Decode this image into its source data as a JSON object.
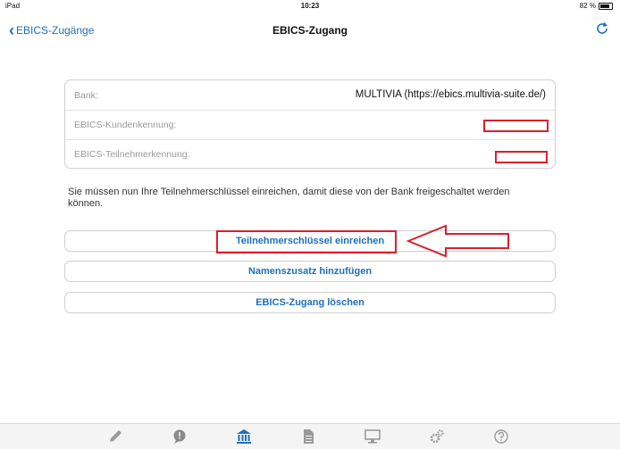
{
  "status": {
    "device": "iPad",
    "time": "10:23",
    "battery": "82 %"
  },
  "nav": {
    "back_label": "EBICS-Zugänge",
    "title": "EBICS-Zugang"
  },
  "info": {
    "bank_label": "Bank:",
    "bank_value": "MULTIVIA (https://ebics.multivia-suite.de/)",
    "customer_id_label": "EBICS-Kundenkennung:",
    "user_id_label": "EBICS-Teilnehmerkennung:"
  },
  "notice": "Sie müssen nun Ihre Teilnehmerschlüssel einreichen, damit diese von der Bank freigeschaltet werden können.",
  "buttons": {
    "submit_keys": "Teilnehmerschlüssel einreichen",
    "add_name_suffix": "Namenszusatz hinzufügen",
    "delete_access": "EBICS-Zugang löschen"
  },
  "tabs": [
    {
      "icon": "pencil-icon"
    },
    {
      "icon": "speech-bubble-icon"
    },
    {
      "icon": "bank-icon",
      "active": true
    },
    {
      "icon": "document-icon"
    },
    {
      "icon": "monitor-icon"
    },
    {
      "icon": "gears-icon"
    },
    {
      "icon": "help-icon"
    }
  ],
  "colors": {
    "accent": "#1d70b8",
    "annotation": "#d9202f"
  }
}
